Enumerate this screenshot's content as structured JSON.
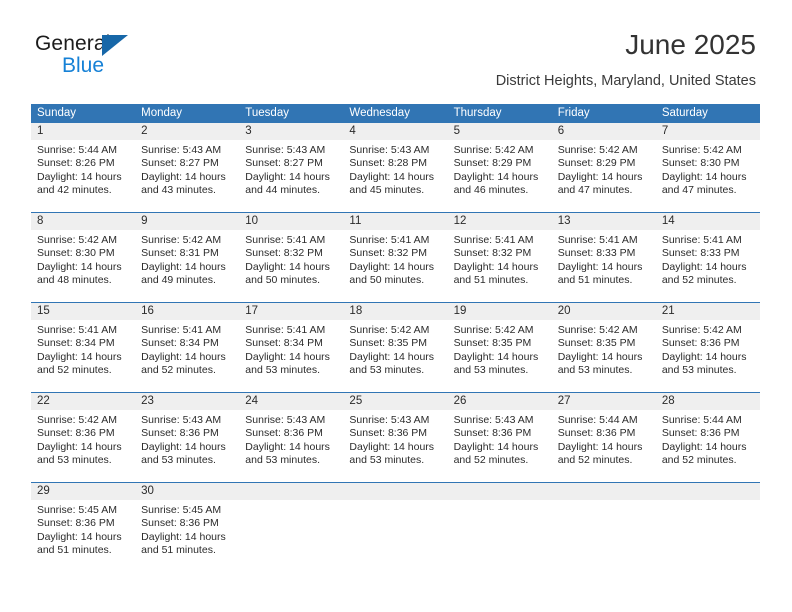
{
  "brand": {
    "name_top": "General",
    "name_bottom": "Blue",
    "triangle_color": "#1767a8",
    "blue_text_color": "#1681d6"
  },
  "header": {
    "title": "June 2025",
    "subtitle": "District Heights, Maryland, United States"
  },
  "theme": {
    "header_blue": "#3175b4",
    "daynum_band": "#efefef",
    "text": "#2b2b2b"
  },
  "calendar": {
    "weekdays": [
      "Sunday",
      "Monday",
      "Tuesday",
      "Wednesday",
      "Thursday",
      "Friday",
      "Saturday"
    ],
    "weeks": [
      [
        {
          "day": "1",
          "lines": [
            "Sunrise: 5:44 AM",
            "Sunset: 8:26 PM",
            "Daylight: 14 hours",
            "and 42 minutes."
          ]
        },
        {
          "day": "2",
          "lines": [
            "Sunrise: 5:43 AM",
            "Sunset: 8:27 PM",
            "Daylight: 14 hours",
            "and 43 minutes."
          ]
        },
        {
          "day": "3",
          "lines": [
            "Sunrise: 5:43 AM",
            "Sunset: 8:27 PM",
            "Daylight: 14 hours",
            "and 44 minutes."
          ]
        },
        {
          "day": "4",
          "lines": [
            "Sunrise: 5:43 AM",
            "Sunset: 8:28 PM",
            "Daylight: 14 hours",
            "and 45 minutes."
          ]
        },
        {
          "day": "5",
          "lines": [
            "Sunrise: 5:42 AM",
            "Sunset: 8:29 PM",
            "Daylight: 14 hours",
            "and 46 minutes."
          ]
        },
        {
          "day": "6",
          "lines": [
            "Sunrise: 5:42 AM",
            "Sunset: 8:29 PM",
            "Daylight: 14 hours",
            "and 47 minutes."
          ]
        },
        {
          "day": "7",
          "lines": [
            "Sunrise: 5:42 AM",
            "Sunset: 8:30 PM",
            "Daylight: 14 hours",
            "and 47 minutes."
          ]
        }
      ],
      [
        {
          "day": "8",
          "lines": [
            "Sunrise: 5:42 AM",
            "Sunset: 8:30 PM",
            "Daylight: 14 hours",
            "and 48 minutes."
          ]
        },
        {
          "day": "9",
          "lines": [
            "Sunrise: 5:42 AM",
            "Sunset: 8:31 PM",
            "Daylight: 14 hours",
            "and 49 minutes."
          ]
        },
        {
          "day": "10",
          "lines": [
            "Sunrise: 5:41 AM",
            "Sunset: 8:32 PM",
            "Daylight: 14 hours",
            "and 50 minutes."
          ]
        },
        {
          "day": "11",
          "lines": [
            "Sunrise: 5:41 AM",
            "Sunset: 8:32 PM",
            "Daylight: 14 hours",
            "and 50 minutes."
          ]
        },
        {
          "day": "12",
          "lines": [
            "Sunrise: 5:41 AM",
            "Sunset: 8:32 PM",
            "Daylight: 14 hours",
            "and 51 minutes."
          ]
        },
        {
          "day": "13",
          "lines": [
            "Sunrise: 5:41 AM",
            "Sunset: 8:33 PM",
            "Daylight: 14 hours",
            "and 51 minutes."
          ]
        },
        {
          "day": "14",
          "lines": [
            "Sunrise: 5:41 AM",
            "Sunset: 8:33 PM",
            "Daylight: 14 hours",
            "and 52 minutes."
          ]
        }
      ],
      [
        {
          "day": "15",
          "lines": [
            "Sunrise: 5:41 AM",
            "Sunset: 8:34 PM",
            "Daylight: 14 hours",
            "and 52 minutes."
          ]
        },
        {
          "day": "16",
          "lines": [
            "Sunrise: 5:41 AM",
            "Sunset: 8:34 PM",
            "Daylight: 14 hours",
            "and 52 minutes."
          ]
        },
        {
          "day": "17",
          "lines": [
            "Sunrise: 5:41 AM",
            "Sunset: 8:34 PM",
            "Daylight: 14 hours",
            "and 53 minutes."
          ]
        },
        {
          "day": "18",
          "lines": [
            "Sunrise: 5:42 AM",
            "Sunset: 8:35 PM",
            "Daylight: 14 hours",
            "and 53 minutes."
          ]
        },
        {
          "day": "19",
          "lines": [
            "Sunrise: 5:42 AM",
            "Sunset: 8:35 PM",
            "Daylight: 14 hours",
            "and 53 minutes."
          ]
        },
        {
          "day": "20",
          "lines": [
            "Sunrise: 5:42 AM",
            "Sunset: 8:35 PM",
            "Daylight: 14 hours",
            "and 53 minutes."
          ]
        },
        {
          "day": "21",
          "lines": [
            "Sunrise: 5:42 AM",
            "Sunset: 8:36 PM",
            "Daylight: 14 hours",
            "and 53 minutes."
          ]
        }
      ],
      [
        {
          "day": "22",
          "lines": [
            "Sunrise: 5:42 AM",
            "Sunset: 8:36 PM",
            "Daylight: 14 hours",
            "and 53 minutes."
          ]
        },
        {
          "day": "23",
          "lines": [
            "Sunrise: 5:43 AM",
            "Sunset: 8:36 PM",
            "Daylight: 14 hours",
            "and 53 minutes."
          ]
        },
        {
          "day": "24",
          "lines": [
            "Sunrise: 5:43 AM",
            "Sunset: 8:36 PM",
            "Daylight: 14 hours",
            "and 53 minutes."
          ]
        },
        {
          "day": "25",
          "lines": [
            "Sunrise: 5:43 AM",
            "Sunset: 8:36 PM",
            "Daylight: 14 hours",
            "and 53 minutes."
          ]
        },
        {
          "day": "26",
          "lines": [
            "Sunrise: 5:43 AM",
            "Sunset: 8:36 PM",
            "Daylight: 14 hours",
            "and 52 minutes."
          ]
        },
        {
          "day": "27",
          "lines": [
            "Sunrise: 5:44 AM",
            "Sunset: 8:36 PM",
            "Daylight: 14 hours",
            "and 52 minutes."
          ]
        },
        {
          "day": "28",
          "lines": [
            "Sunrise: 5:44 AM",
            "Sunset: 8:36 PM",
            "Daylight: 14 hours",
            "and 52 minutes."
          ]
        }
      ],
      [
        {
          "day": "29",
          "lines": [
            "Sunrise: 5:45 AM",
            "Sunset: 8:36 PM",
            "Daylight: 14 hours",
            "and 51 minutes."
          ]
        },
        {
          "day": "30",
          "lines": [
            "Sunrise: 5:45 AM",
            "Sunset: 8:36 PM",
            "Daylight: 14 hours",
            "and 51 minutes."
          ]
        },
        {
          "day": "",
          "lines": []
        },
        {
          "day": "",
          "lines": []
        },
        {
          "day": "",
          "lines": []
        },
        {
          "day": "",
          "lines": []
        },
        {
          "day": "",
          "lines": []
        }
      ]
    ]
  }
}
